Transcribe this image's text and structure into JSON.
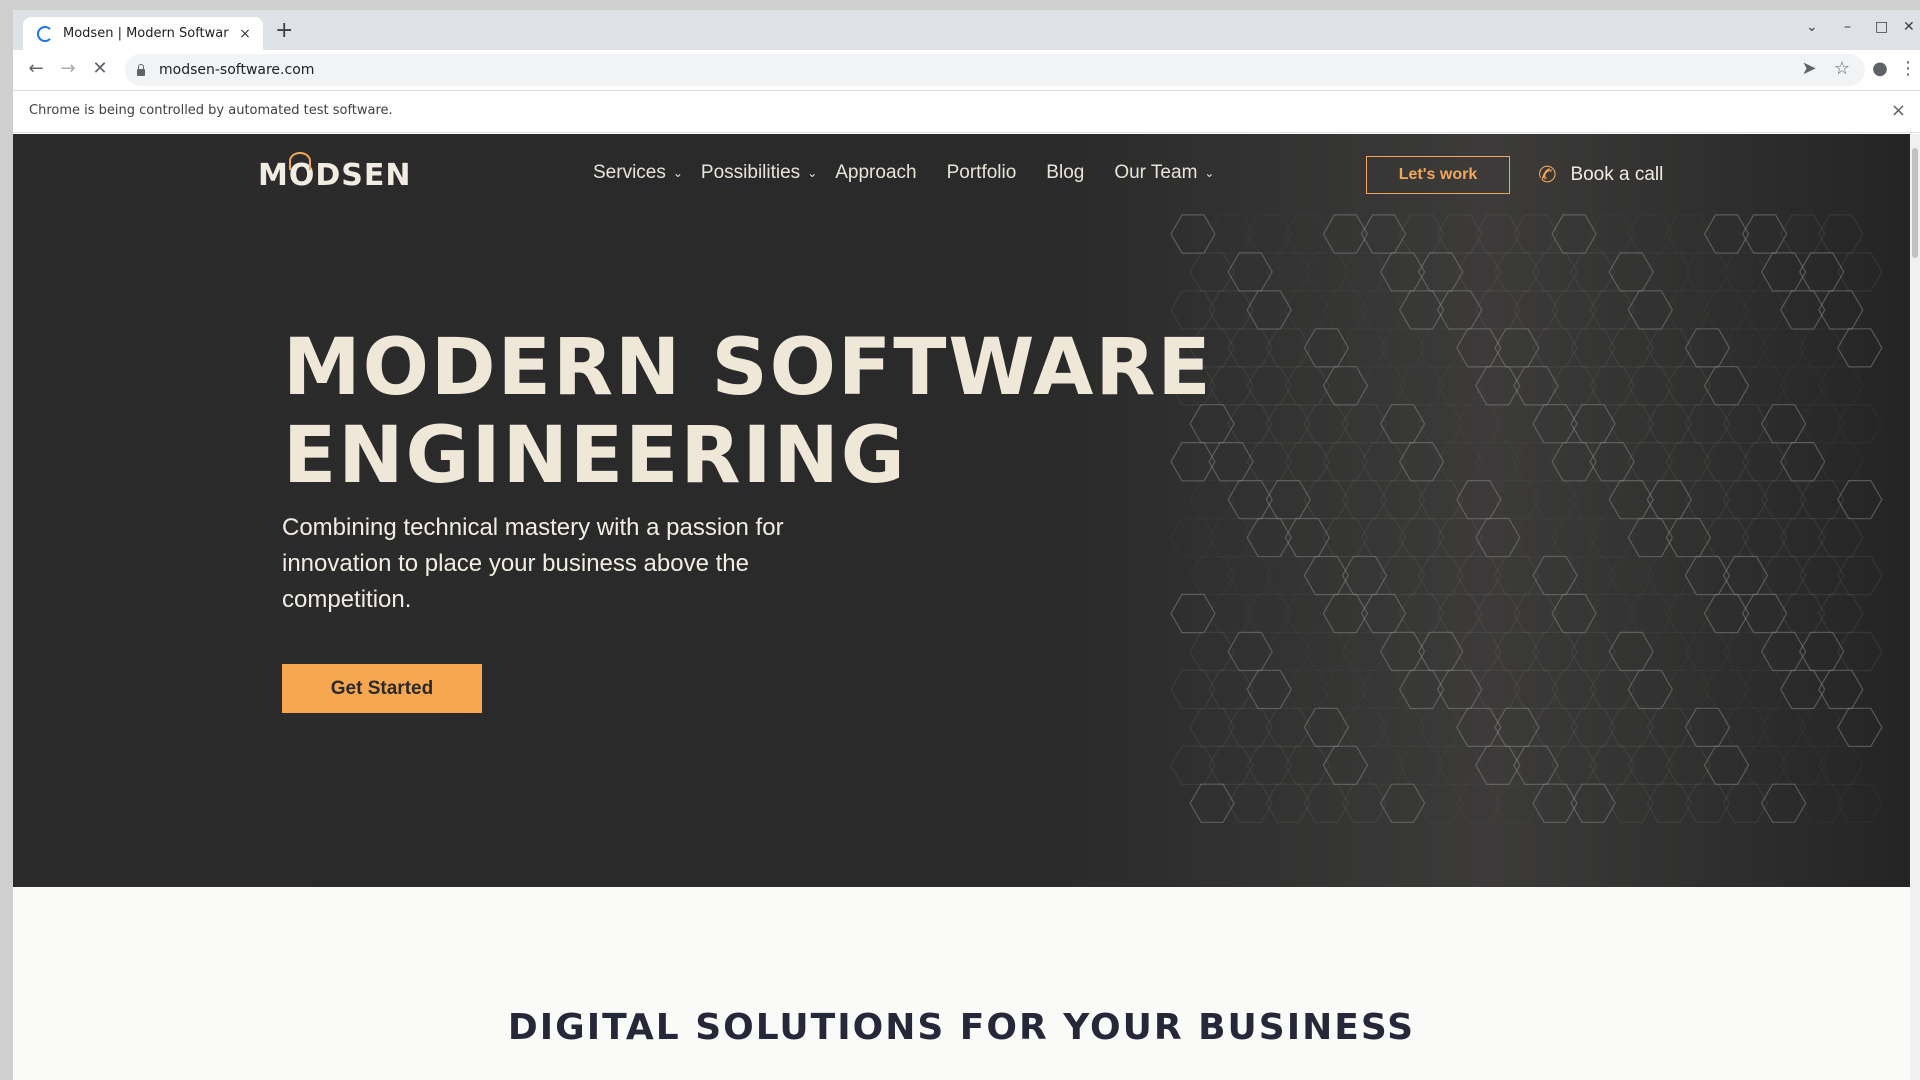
{
  "browser": {
    "tab_title": "Modsen | Modern Software",
    "tab_close": "×",
    "new_tab": "+",
    "url": "modsen-software.com",
    "infobar_text": "Chrome is being controlled by automated test software.",
    "infobar_close": "×"
  },
  "site": {
    "logo_text": "MODSEN",
    "nav": [
      {
        "label": "Services",
        "has_dropdown": true
      },
      {
        "label": "Possibilities",
        "has_dropdown": true
      },
      {
        "label": "Approach",
        "has_dropdown": false
      },
      {
        "label": "Portfolio",
        "has_dropdown": false
      },
      {
        "label": "Blog",
        "has_dropdown": false
      },
      {
        "label": "Our Team",
        "has_dropdown": true
      }
    ],
    "lets_work": "Let's work",
    "book_call": "Book a call",
    "hero_line1": "MODERN SOFTWARE",
    "hero_line2": "ENGINEERING",
    "hero_sub": "Combining technical mastery with a passion for innovation to place your business above the competition.",
    "cta": "Get Started",
    "section_title": "DIGITAL SOLUTIONS FOR YOUR BUSINESS"
  },
  "colors": {
    "accent": "#f7a750",
    "hero_bg": "#2b2b2b",
    "hero_text": "#efe8d8",
    "section_title": "#26283a"
  },
  "icons": [
    "tab-spinner-icon",
    "back-arrow-icon",
    "forward-arrow-icon",
    "stop-icon",
    "lock-icon",
    "send-icon",
    "star-icon",
    "profile-icon",
    "menu-icon",
    "phone-icon",
    "chevron-down-icon"
  ]
}
